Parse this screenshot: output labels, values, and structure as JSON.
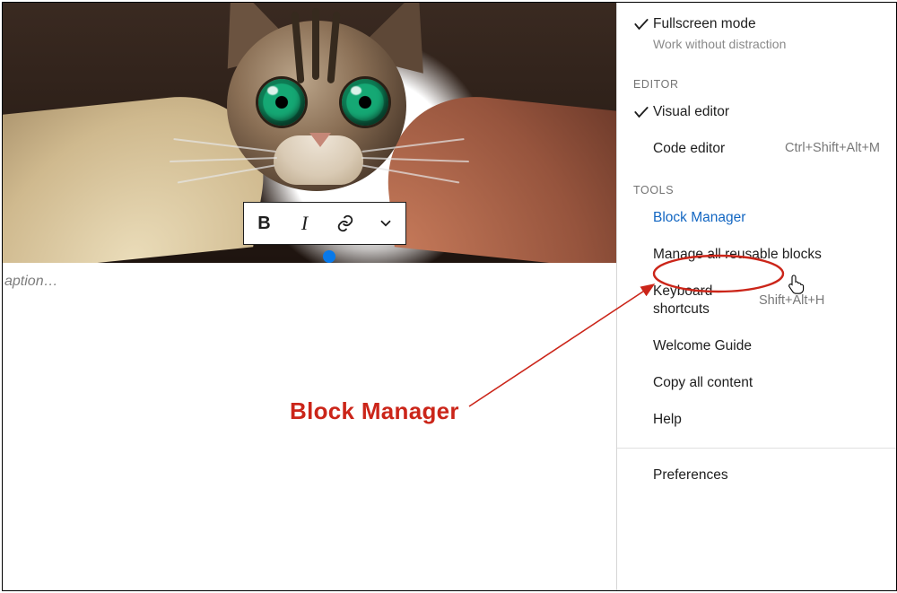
{
  "editor": {
    "caption_placeholder": "aption…"
  },
  "toolbar": {
    "bold": "B",
    "italic": "I"
  },
  "menu": {
    "fullscreen": {
      "label": "Fullscreen mode",
      "sub": "Work without distraction"
    },
    "group_editor": "EDITOR",
    "visual_editor": "Visual editor",
    "code_editor": {
      "label": "Code editor",
      "kbd": "Ctrl+Shift+Alt+M"
    },
    "group_tools": "TOOLS",
    "block_manager": "Block Manager",
    "manage_reusable": "Manage all reusable blocks",
    "keyboard_shortcuts": {
      "label": "Keyboard shortcuts",
      "kbd": "Shift+Alt+H"
    },
    "welcome_guide": "Welcome Guide",
    "copy_all": "Copy all content",
    "help": "Help",
    "preferences": "Preferences"
  },
  "annotation": {
    "label": "Block Manager"
  }
}
